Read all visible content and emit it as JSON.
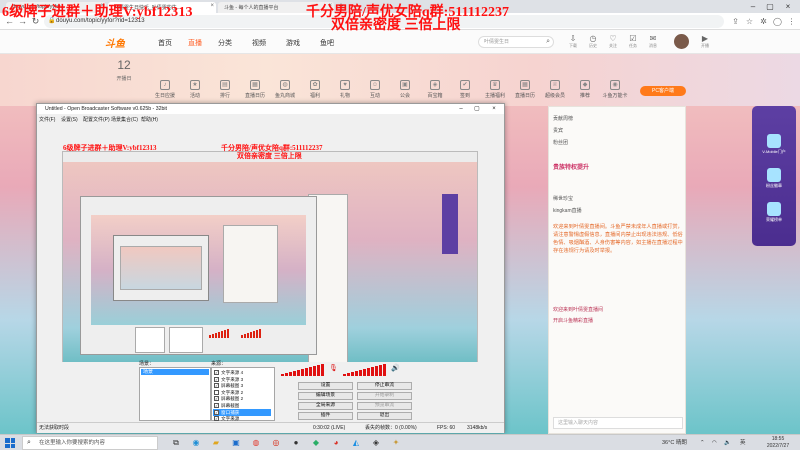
{
  "browser": {
    "tabs": [
      {
        "title": "douyu.com/topic/yyfor..."
      },
      {
        "title": "叶倩雯生日快乐_叶倩雯的生...",
        "active": true
      },
      {
        "title": "斗鱼 - 每个人的直播平台"
      }
    ],
    "url": "douyu.com/topic/yyfor?rid=12313"
  },
  "overlay": {
    "line1": "6级牌子进群＋助理V:ybf12313",
    "line2": "千分男陪/声优女陪q群:511112237",
    "line3": "双倍亲密度 三倍上限"
  },
  "site": {
    "nav": [
      "首页",
      "直播",
      "分类",
      "视频",
      "游戏",
      "鱼吧"
    ],
    "nav_active": 1,
    "search_placeholder": "叶倩雯生日",
    "header_icons": [
      {
        "name": "download-icon",
        "label": "下载"
      },
      {
        "name": "history-icon",
        "label": "历史"
      },
      {
        "name": "follow-icon",
        "label": "关注"
      },
      {
        "name": "task-icon",
        "label": "任务"
      },
      {
        "name": "message-icon",
        "label": "消息"
      },
      {
        "name": "live-icon",
        "label": "开播"
      }
    ],
    "date": {
      "day": "12",
      "label": "开播日"
    },
    "categories": [
      "生日应援",
      "活动",
      "排行",
      "直播日历",
      "鱼丸商城",
      "福利",
      "礼物",
      "互动",
      "公会",
      "百宝箱",
      "签到",
      "主播福利",
      "直播日历",
      "超级会员",
      "推荐",
      "斗鱼万能卡"
    ],
    "pc_badge": "PC客户端"
  },
  "right_panel": {
    "rank_rows": [
      "贡献周榜",
      "贵宾",
      "粉丝团"
    ],
    "title": "贵族特权提升",
    "users": [
      "稀世珍宝",
      "kingkam直播"
    ],
    "message": "欢迎来到叶倩雯直播间。斗鱼严禁未成年人直播或打赏，请注意警惕虚假信息，直播间内禁止出现违法违规、低俗色情、吸烟酗酒、人身伤害等内容，如主播在直播过程中存在违规行为请及时举报。",
    "announcement": "欢迎来到叶倩雯直播间",
    "announcement2": "开启斗鱼精彩直播",
    "input_placeholder": "这里输入聊天内容"
  },
  "side_deco": {
    "items": [
      "V-Mobile门户",
      "粉丝徽章",
      "荣耀榜单"
    ]
  },
  "obs": {
    "title": "Untitled - Open Broadcaster Software v0.625b - 32bit",
    "menu": [
      "文件(F)",
      "设置(S)",
      "配置文件(P)",
      "场景集合(C)",
      "帮助(H)"
    ],
    "scenes_label": "场景：",
    "scenes": [
      "场景"
    ],
    "sources_label": "来源：",
    "sources": [
      {
        "label": "文字来源 4",
        "checked": true
      },
      {
        "label": "文字来源 3",
        "checked": true
      },
      {
        "label": "屏幕截图 3",
        "checked": true
      },
      {
        "label": "文字来源 2",
        "checked": false
      },
      {
        "label": "屏幕截图 2",
        "checked": true
      },
      {
        "label": "屏幕截图",
        "checked": true
      },
      {
        "label": "窗口捕获",
        "checked": true,
        "selected": true
      },
      {
        "label": "文字来源",
        "checked": true
      }
    ],
    "buttons": [
      {
        "label": "设置",
        "col": 0
      },
      {
        "label": "停止串流",
        "col": 1
      },
      {
        "label": "编辑场景",
        "col": 0
      },
      {
        "label": "开始录制",
        "col": 1,
        "disabled": true
      },
      {
        "label": "全局来源",
        "col": 0
      },
      {
        "label": "预览串流",
        "col": 1,
        "disabled": true
      },
      {
        "label": "插件",
        "col": 0
      },
      {
        "label": "退出",
        "col": 1
      }
    ],
    "status": {
      "left": "无法获取时段",
      "time": "0:30:02 (LIVE)",
      "dropped": "丢失的帧数：0 (0.00%)",
      "fps": "FPS: 60",
      "bitrate": "3148kb/s"
    },
    "nested_ad1": "6级牌子进群＋助理V:ybf12313",
    "nested_ad2": "千分男陪/声优女陪q群:511112237",
    "nested_ad3": "双倍亲密度 三倍上限"
  },
  "taskbar": {
    "search_placeholder": "在这里输入你要搜索的内容",
    "apps": [
      {
        "name": "task-view-icon",
        "glyph": "⧉",
        "color": "#333"
      },
      {
        "name": "edge-icon",
        "glyph": "◉",
        "color": "#1f8fd6"
      },
      {
        "name": "file-explorer-icon",
        "glyph": "▰",
        "color": "#e0a61f"
      },
      {
        "name": "store-icon",
        "glyph": "▣",
        "color": "#1a6ccc"
      },
      {
        "name": "weibo-icon",
        "glyph": "◍",
        "color": "#e23b2e"
      },
      {
        "name": "netease-icon",
        "glyph": "◎",
        "color": "#d81e06"
      },
      {
        "name": "obs-icon",
        "glyph": "●",
        "color": "#333"
      },
      {
        "name": "wechat-icon",
        "glyph": "◆",
        "color": "#2aae67"
      },
      {
        "name": "chrome-icon",
        "glyph": "◕",
        "color": "#d93025"
      },
      {
        "name": "qq-icon",
        "glyph": "◭",
        "color": "#1a8fe3"
      },
      {
        "name": "game-icon",
        "glyph": "◈",
        "color": "#333"
      },
      {
        "name": "league-icon",
        "glyph": "✦",
        "color": "#c89b3c"
      }
    ],
    "weather": "36°C 晴朗",
    "ime": "英",
    "time": "18:55",
    "date": "2022/7/27"
  },
  "colors": {
    "overlay_red": "#ff1010",
    "accent_orange": "#ff7700",
    "obs_select": "#3399ff",
    "meter_red": "#e01010"
  }
}
